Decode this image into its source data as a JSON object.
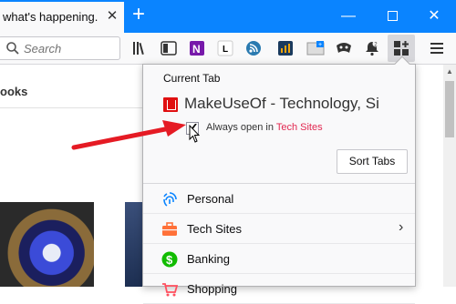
{
  "browser": {
    "tab_title": "what's happening.",
    "tab_close": "✕",
    "newtab": "+",
    "window_min": "—",
    "window_close": "✕"
  },
  "toolbar": {
    "search_placeholder": "Search"
  },
  "page": {
    "heading_fragment": "ooks"
  },
  "panel": {
    "current_tab_label": "Current Tab",
    "site_title": "MakeUseOf - Technology, Si",
    "always_open_prefix": "Always open in ",
    "always_open_link": "Tech Sites",
    "sort_button": "Sort Tabs",
    "items": [
      {
        "label": "Personal",
        "icon": "fingerprint-icon",
        "color": "#0a84ff"
      },
      {
        "label": "Tech Sites",
        "icon": "briefcase-icon",
        "color": "#ff7139",
        "chevron": "›"
      },
      {
        "label": "Banking",
        "icon": "dollar-icon",
        "color": "#12bc00"
      },
      {
        "label": "Shopping",
        "icon": "cart-icon",
        "color": "#ff4f5e"
      }
    ]
  },
  "colors": {
    "tabstrip": "#0a84ff",
    "link": "#e22850",
    "arrow": "#e51b24"
  }
}
